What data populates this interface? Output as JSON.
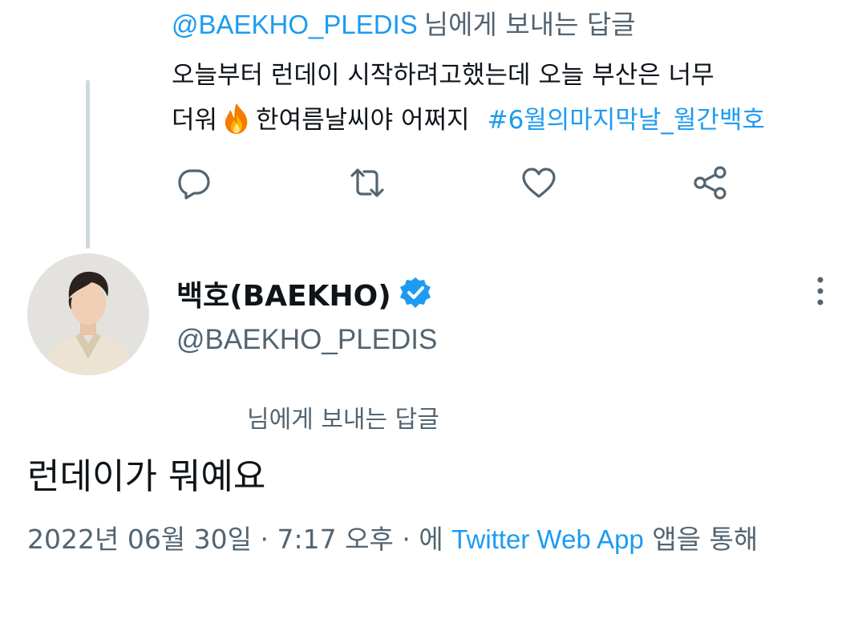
{
  "reply_context_top": {
    "handle": "@BAEKHO_PLEDIS",
    "suffix": "님에게 보내는 답글"
  },
  "parent_tweet": {
    "line1": "오늘부터 런데이 시작하려고했는데 오늘 부산은 너무",
    "line2_before": "더워",
    "emoji": "fire-icon",
    "line2_after": "한여름날씨야 어쩌지",
    "hashtag": "#6월의마지막날_월간백호"
  },
  "actions": [
    "reply-icon",
    "retweet-icon",
    "like-icon",
    "share-icon"
  ],
  "author": {
    "display_name": "백호(BAEKHO)",
    "handle": "@BAEKHO_PLEDIS",
    "verified": true
  },
  "reply_context_bottom": "님에게 보내는 답글",
  "tweet_text": "런데이가 뭐예요",
  "meta": {
    "date": "2022년 06월 30일",
    "sep1": " · ",
    "time": "7:17 오후",
    "sep2": " · ",
    "via_prefix": "에 ",
    "source": "Twitter Web App",
    "via_suffix": " 앱을 통해"
  },
  "colors": {
    "accent": "#1d9bf0",
    "secondary": "#536471",
    "text": "#0f1419",
    "thread_line": "#cfd9de"
  }
}
